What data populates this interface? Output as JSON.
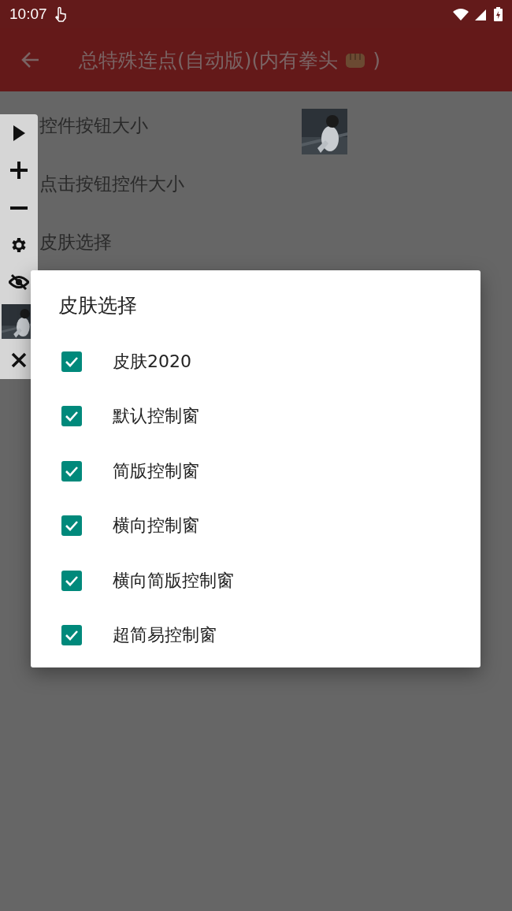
{
  "status_bar": {
    "time": "10:07"
  },
  "app_bar": {
    "title": "总特殊连点(自动版)(内有拳头",
    "title_end": ")"
  },
  "settings": [
    {
      "label": "控件按钮大小",
      "kind": "picture"
    },
    {
      "label": "点击按钮控件大小"
    },
    {
      "label": "皮肤选择"
    }
  ],
  "floating_toolbar": [
    {
      "kind": "play"
    },
    {
      "kind": "plus"
    },
    {
      "kind": "minus"
    },
    {
      "kind": "gear"
    },
    {
      "kind": "eye-off"
    },
    {
      "kind": "picture"
    },
    {
      "kind": "close"
    }
  ],
  "dialog": {
    "title": "皮肤选择",
    "options": [
      {
        "label": "皮肤2020",
        "checked": true
      },
      {
        "label": "默认控制窗",
        "checked": true
      },
      {
        "label": "简版控制窗",
        "checked": true
      },
      {
        "label": "横向控制窗",
        "checked": true
      },
      {
        "label": "横向简版控制窗",
        "checked": true
      },
      {
        "label": "超简易控制窗",
        "checked": true
      }
    ]
  }
}
